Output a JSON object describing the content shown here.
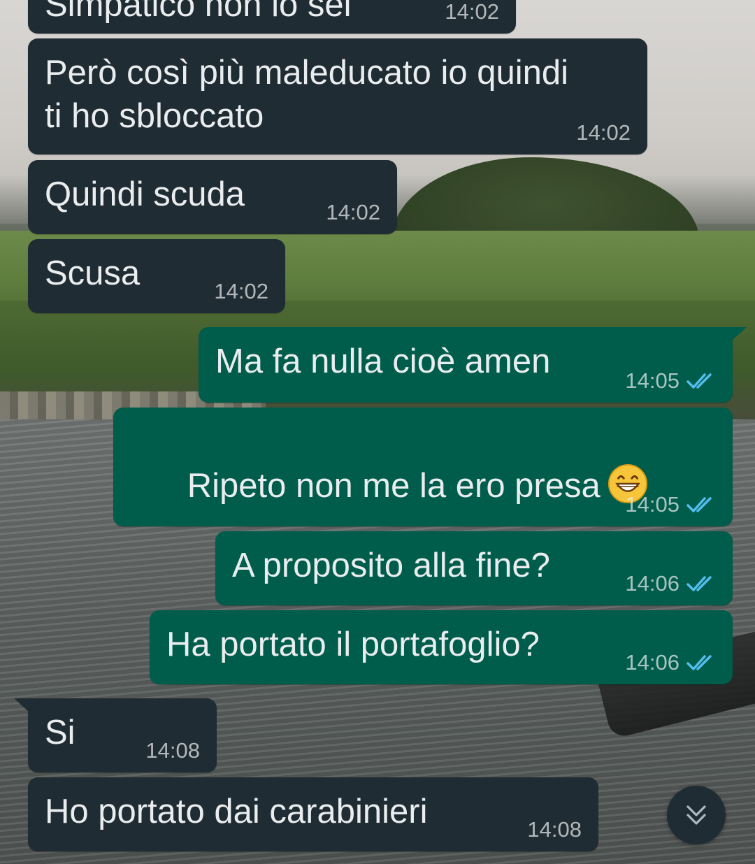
{
  "colors": {
    "incoming_bubble": "#202c33",
    "outgoing_bubble": "#005c4b",
    "text_primary": "#e9edef",
    "timestamp": "#9aa5aa",
    "read_ticks": "#53bdeb"
  },
  "messages": [
    {
      "direction": "in",
      "text": "Simpatico non lo sei",
      "time": "14:02"
    },
    {
      "direction": "in",
      "text": "Però così più maleducato io quindi\nti ho sbloccato",
      "time": "14:02"
    },
    {
      "direction": "in",
      "text": "Quindi scuda",
      "time": "14:02"
    },
    {
      "direction": "in",
      "text": "Scusa",
      "time": "14:02"
    },
    {
      "direction": "out",
      "text": "Ma fa nulla cioè amen",
      "time": "14:05",
      "status": "read"
    },
    {
      "direction": "out",
      "text": "Ripeto non me la ero presa",
      "emoji": "grinning-face-with-smiling-eyes",
      "time": "14:05",
      "status": "read"
    },
    {
      "direction": "out",
      "text": "A proposito alla fine?",
      "time": "14:06",
      "status": "read"
    },
    {
      "direction": "out",
      "text": "Ha portato il portafoglio?",
      "time": "14:06",
      "status": "read"
    },
    {
      "direction": "in",
      "text": "Si",
      "time": "14:08"
    },
    {
      "direction": "in",
      "text": "Ho portato dai carabinieri",
      "time": "14:08"
    }
  ],
  "scroll_button": {
    "icon": "double-chevron-down-icon"
  }
}
